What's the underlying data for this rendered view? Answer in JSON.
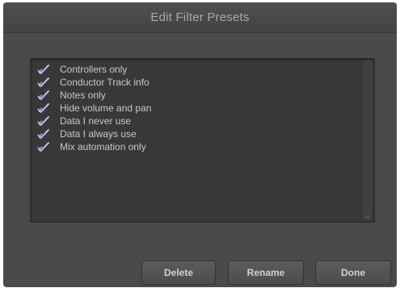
{
  "window": {
    "title": "Edit Filter Presets"
  },
  "presets": {
    "items": [
      {
        "label": "Controllers only",
        "icon": "checkmark-pen-icon"
      },
      {
        "label": "Conductor Track info",
        "icon": "checkmark-pen-icon"
      },
      {
        "label": "Notes only",
        "icon": "checkmark-pen-icon"
      },
      {
        "label": "Hide volume and pan",
        "icon": "checkmark-pen-icon"
      },
      {
        "label": "Data I never use",
        "icon": "checkmark-pen-icon"
      },
      {
        "label": "Data I always use",
        "icon": "checkmark-pen-icon"
      },
      {
        "label": "Mix automation only",
        "icon": "checkmark-pen-icon"
      }
    ]
  },
  "buttons": {
    "delete_label": "Delete",
    "rename_label": "Rename",
    "done_label": "Done"
  },
  "colors": {
    "window_bg": "#4a4a4a",
    "list_bg": "#383838",
    "text": "#c8c8c8",
    "icon": "#b8bde8"
  }
}
